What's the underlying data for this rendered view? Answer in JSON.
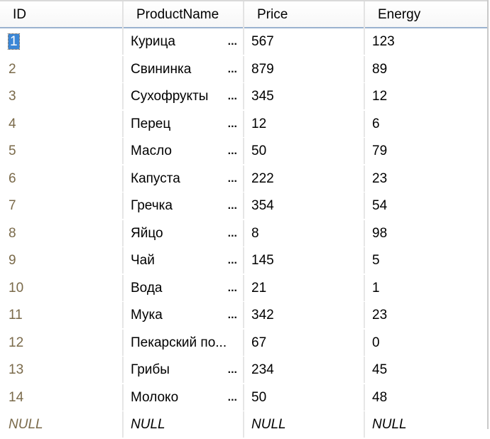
{
  "columns": {
    "id": "ID",
    "name": "ProductName",
    "price": "Price",
    "energy": "Energy"
  },
  "rows": [
    {
      "id": "1",
      "name": "Курица",
      "price": "567",
      "energy": "123"
    },
    {
      "id": "2",
      "name": "Свининка",
      "price": "879",
      "energy": "89"
    },
    {
      "id": "3",
      "name": "Сухофрукты",
      "price": "345",
      "energy": "12"
    },
    {
      "id": "4",
      "name": "Перец",
      "price": "12",
      "energy": "6"
    },
    {
      "id": "5",
      "name": "Масло",
      "price": "50",
      "energy": "79"
    },
    {
      "id": "6",
      "name": "Капуста",
      "price": "222",
      "energy": "23"
    },
    {
      "id": "7",
      "name": "Гречка",
      "price": "354",
      "energy": "54"
    },
    {
      "id": "8",
      "name": "Яйцо",
      "price": "8",
      "energy": "98"
    },
    {
      "id": "9",
      "name": "Чай",
      "price": "145",
      "energy": "5"
    },
    {
      "id": "10",
      "name": "Вода",
      "price": "21",
      "energy": "1"
    },
    {
      "id": "11",
      "name": "Мука",
      "price": "342",
      "energy": "23"
    },
    {
      "id": "12",
      "name": "Пекарский по...",
      "price": "67",
      "energy": "0"
    },
    {
      "id": "13",
      "name": "Грибы",
      "price": "234",
      "energy": "45"
    },
    {
      "id": "14",
      "name": "Молоко",
      "price": "50",
      "energy": "48"
    }
  ],
  "null_row": {
    "id": "NULL",
    "name": "NULL",
    "price": "NULL",
    "energy": "NULL"
  },
  "ellipsis": "...",
  "selection_color": "#3a86d6"
}
